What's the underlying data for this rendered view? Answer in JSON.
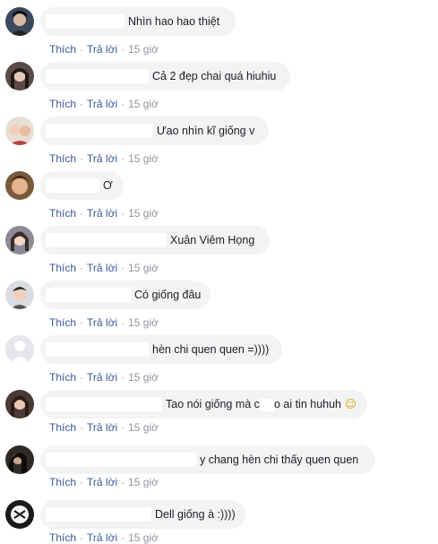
{
  "comments": [
    {
      "text": "Nhìn hao hao thiệt",
      "like": "Thích",
      "reply": "Trả lời",
      "time": "15 giờ"
    },
    {
      "text": "Cả 2 đẹp chai quá hiuhiu",
      "like": "Thích",
      "reply": "Trả lời",
      "time": "15 giờ"
    },
    {
      "text": "Ưao nhìn kĩ giống v",
      "like": "Thích",
      "reply": "Trả lời",
      "time": "15 giờ"
    },
    {
      "text": "Ơ",
      "like": "Thích",
      "reply": "Trả lời",
      "time": "15 giờ"
    },
    {
      "text": "Xuân Viêm Họng",
      "like": "Thích",
      "reply": "Trả lời",
      "time": "15 giờ"
    },
    {
      "text": "Có giống đâu",
      "like": "Thích",
      "reply": "Trả lời",
      "time": "15 giờ"
    },
    {
      "text": "hèn chi quen quen =))))",
      "like": "Thích",
      "reply": "Trả lời",
      "time": "15 giờ"
    },
    {
      "text_before": "Tao nói giống mà c",
      "text_after": "o ai tin huhuh",
      "emoji": "☺",
      "like": "Thích",
      "reply": "Trả lời",
      "time": "15 giờ"
    },
    {
      "text": "y chang hèn chi thấy quen quen",
      "like": "Thích",
      "reply": "Trả lời",
      "time": "15 giờ"
    },
    {
      "text": "Dell giống à :))))",
      "like": "Thích",
      "reply": "Trả lời",
      "time": "15 giờ"
    }
  ]
}
